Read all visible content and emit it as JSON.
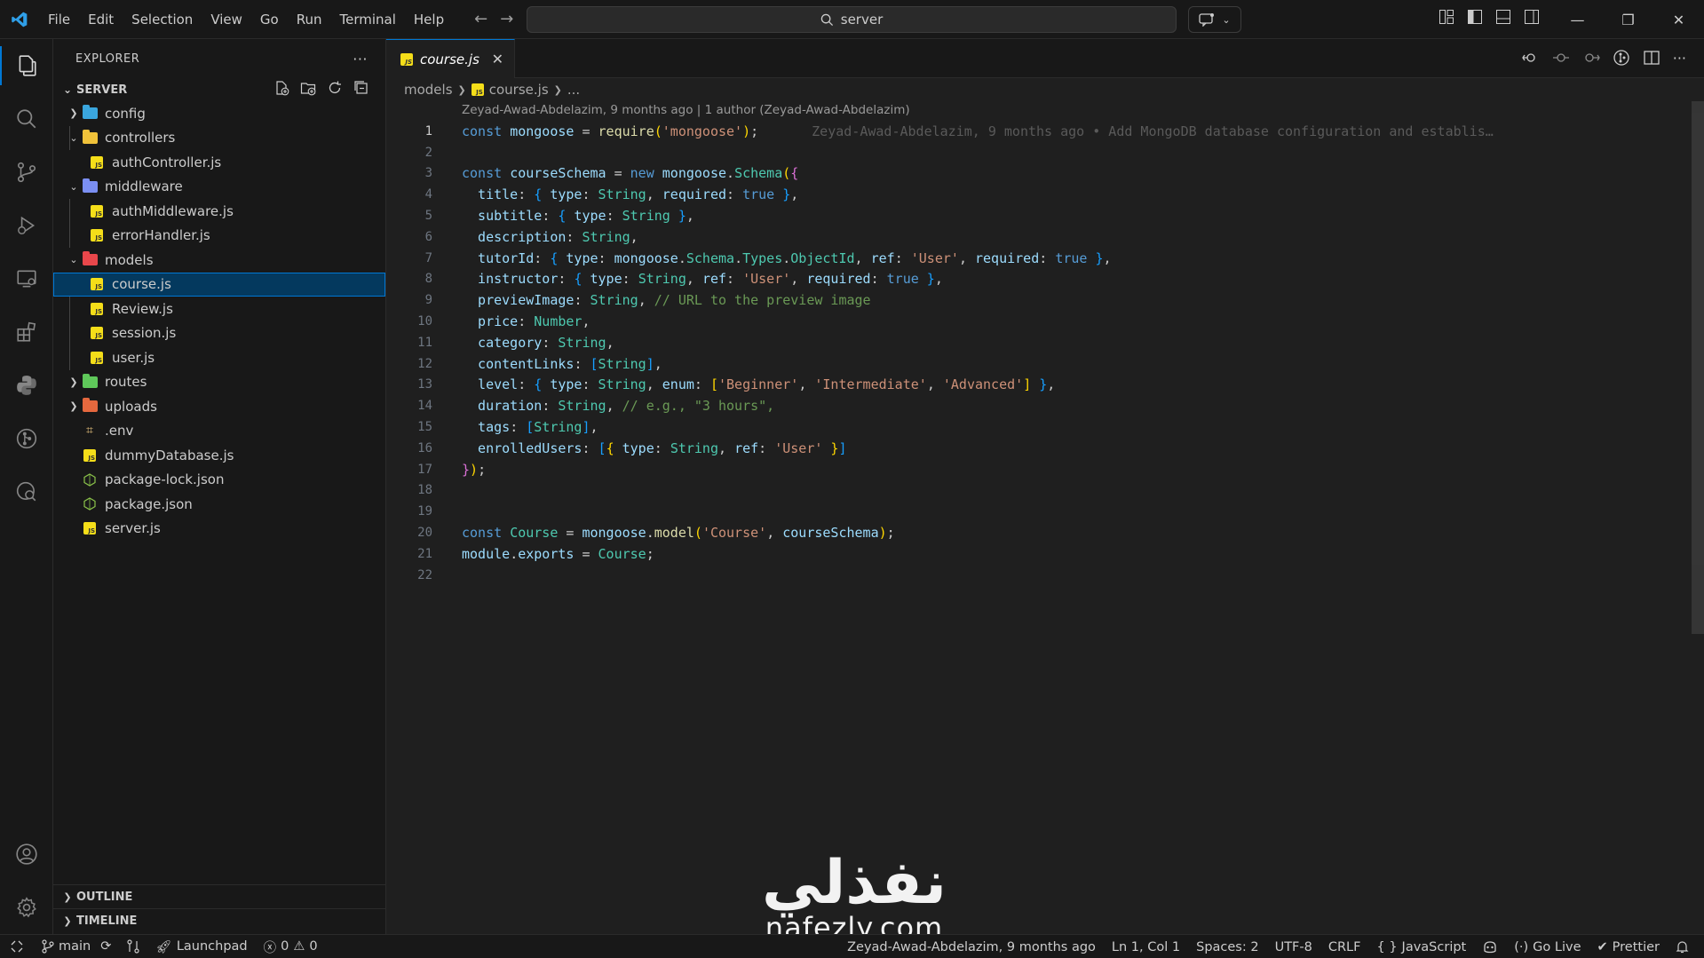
{
  "menu": [
    "File",
    "Edit",
    "Selection",
    "View",
    "Go",
    "Run",
    "Terminal",
    "Help"
  ],
  "search": {
    "text": "server"
  },
  "explorer": {
    "title": "EXPLORER",
    "root": "SERVER",
    "items": [
      {
        "label": "config",
        "type": "folder",
        "level": 0,
        "expanded": false,
        "color": "#3aa6de"
      },
      {
        "label": "controllers",
        "type": "folder",
        "level": 0,
        "expanded": true,
        "color": "#f0c23a"
      },
      {
        "label": "authController.js",
        "type": "js",
        "level": 1
      },
      {
        "label": "middleware",
        "type": "folder",
        "level": 0,
        "expanded": true,
        "color": "#7b8ff2"
      },
      {
        "label": "authMiddleware.js",
        "type": "js",
        "level": 1
      },
      {
        "label": "errorHandler.js",
        "type": "js",
        "level": 1
      },
      {
        "label": "models",
        "type": "folder",
        "level": 0,
        "expanded": true,
        "color": "#e8474b"
      },
      {
        "label": "course.js",
        "type": "js",
        "level": 1,
        "selected": true
      },
      {
        "label": "Review.js",
        "type": "js",
        "level": 1
      },
      {
        "label": "session.js",
        "type": "js",
        "level": 1
      },
      {
        "label": "user.js",
        "type": "js",
        "level": 1
      },
      {
        "label": "routes",
        "type": "folder",
        "level": 0,
        "expanded": false,
        "color": "#5fc85a"
      },
      {
        "label": "uploads",
        "type": "folder",
        "level": 0,
        "expanded": false,
        "color": "#e5683e"
      },
      {
        "label": ".env",
        "type": "env",
        "level": 0
      },
      {
        "label": "dummyDatabase.js",
        "type": "js",
        "level": 0
      },
      {
        "label": "package-lock.json",
        "type": "json",
        "level": 0
      },
      {
        "label": "package.json",
        "type": "json",
        "level": 0
      },
      {
        "label": "server.js",
        "type": "js",
        "level": 0
      }
    ],
    "outline": "OUTLINE",
    "timeline": "TIMELINE"
  },
  "tab": {
    "label": "course.js"
  },
  "breadcrumb": {
    "folder": "models",
    "file": "course.js",
    "more": "..."
  },
  "blame": {
    "header": "Zeyad-Awad-Abdelazim, 9 months ago | 1 author (Zeyad-Awad-Abdelazim)",
    "inline": "Zeyad-Awad-Abdelazim, 9 months ago • Add MongoDB database configuration and establis…"
  },
  "code_lines": [
    [
      [
        "k",
        "const "
      ],
      [
        "v",
        "mongoose"
      ],
      [
        "p",
        " = "
      ],
      [
        "f",
        "require"
      ],
      [
        "b1",
        "("
      ],
      [
        "s",
        "'mongoose'"
      ],
      [
        "b1",
        ")"
      ],
      [
        "p",
        ";"
      ]
    ],
    [],
    [
      [
        "k",
        "const "
      ],
      [
        "v",
        "courseSchema"
      ],
      [
        "p",
        " = "
      ],
      [
        "k",
        "new "
      ],
      [
        "v",
        "mongoose"
      ],
      [
        "p",
        "."
      ],
      [
        "c",
        "Schema"
      ],
      [
        "b1",
        "("
      ],
      [
        "b2",
        "{"
      ]
    ],
    [
      [
        "v",
        "  title"
      ],
      [
        "p",
        ": "
      ],
      [
        "b3",
        "{ "
      ],
      [
        "v",
        "type"
      ],
      [
        "p",
        ": "
      ],
      [
        "c",
        "String"
      ],
      [
        "p",
        ", "
      ],
      [
        "v",
        "required"
      ],
      [
        "p",
        ": "
      ],
      [
        "k",
        "true"
      ],
      [
        "b3",
        " }"
      ],
      [
        "p",
        ","
      ]
    ],
    [
      [
        "v",
        "  subtitle"
      ],
      [
        "p",
        ": "
      ],
      [
        "b3",
        "{ "
      ],
      [
        "v",
        "type"
      ],
      [
        "p",
        ": "
      ],
      [
        "c",
        "String"
      ],
      [
        "b3",
        " }"
      ],
      [
        "p",
        ","
      ]
    ],
    [
      [
        "v",
        "  description"
      ],
      [
        "p",
        ": "
      ],
      [
        "c",
        "String"
      ],
      [
        "p",
        ","
      ]
    ],
    [
      [
        "v",
        "  tutorId"
      ],
      [
        "p",
        ": "
      ],
      [
        "b3",
        "{ "
      ],
      [
        "v",
        "type"
      ],
      [
        "p",
        ": "
      ],
      [
        "v",
        "mongoose"
      ],
      [
        "p",
        "."
      ],
      [
        "c",
        "Schema"
      ],
      [
        "p",
        "."
      ],
      [
        "c",
        "Types"
      ],
      [
        "p",
        "."
      ],
      [
        "c",
        "ObjectId"
      ],
      [
        "p",
        ", "
      ],
      [
        "v",
        "ref"
      ],
      [
        "p",
        ": "
      ],
      [
        "s",
        "'User'"
      ],
      [
        "p",
        ", "
      ],
      [
        "v",
        "required"
      ],
      [
        "p",
        ": "
      ],
      [
        "k",
        "true"
      ],
      [
        "b3",
        " }"
      ],
      [
        "p",
        ","
      ]
    ],
    [
      [
        "v",
        "  instructor"
      ],
      [
        "p",
        ": "
      ],
      [
        "b3",
        "{ "
      ],
      [
        "v",
        "type"
      ],
      [
        "p",
        ": "
      ],
      [
        "c",
        "String"
      ],
      [
        "p",
        ", "
      ],
      [
        "v",
        "ref"
      ],
      [
        "p",
        ": "
      ],
      [
        "s",
        "'User'"
      ],
      [
        "p",
        ", "
      ],
      [
        "v",
        "required"
      ],
      [
        "p",
        ": "
      ],
      [
        "k",
        "true"
      ],
      [
        "b3",
        " }"
      ],
      [
        "p",
        ","
      ]
    ],
    [
      [
        "v",
        "  previewImage"
      ],
      [
        "p",
        ": "
      ],
      [
        "c",
        "String"
      ],
      [
        "p",
        ", "
      ],
      [
        "cm",
        "// URL to the preview image"
      ]
    ],
    [
      [
        "v",
        "  price"
      ],
      [
        "p",
        ": "
      ],
      [
        "c",
        "Number"
      ],
      [
        "p",
        ","
      ]
    ],
    [
      [
        "v",
        "  category"
      ],
      [
        "p",
        ": "
      ],
      [
        "c",
        "String"
      ],
      [
        "p",
        ","
      ]
    ],
    [
      [
        "v",
        "  contentLinks"
      ],
      [
        "p",
        ": "
      ],
      [
        "b3",
        "["
      ],
      [
        "c",
        "String"
      ],
      [
        "b3",
        "]"
      ],
      [
        "p",
        ","
      ]
    ],
    [
      [
        "v",
        "  level"
      ],
      [
        "p",
        ": "
      ],
      [
        "b3",
        "{ "
      ],
      [
        "v",
        "type"
      ],
      [
        "p",
        ": "
      ],
      [
        "c",
        "String"
      ],
      [
        "p",
        ", "
      ],
      [
        "v",
        "enum"
      ],
      [
        "p",
        ": "
      ],
      [
        "b1",
        "["
      ],
      [
        "s",
        "'Beginner'"
      ],
      [
        "p",
        ", "
      ],
      [
        "s",
        "'Intermediate'"
      ],
      [
        "p",
        ", "
      ],
      [
        "s",
        "'Advanced'"
      ],
      [
        "b1",
        "]"
      ],
      [
        "b3",
        " }"
      ],
      [
        "p",
        ","
      ]
    ],
    [
      [
        "v",
        "  duration"
      ],
      [
        "p",
        ": "
      ],
      [
        "c",
        "String"
      ],
      [
        "p",
        ", "
      ],
      [
        "cm",
        "// e.g., \"3 hours\","
      ]
    ],
    [
      [
        "v",
        "  tags"
      ],
      [
        "p",
        ": "
      ],
      [
        "b3",
        "["
      ],
      [
        "c",
        "String"
      ],
      [
        "b3",
        "]"
      ],
      [
        "p",
        ","
      ]
    ],
    [
      [
        "v",
        "  enrolledUsers"
      ],
      [
        "p",
        ": "
      ],
      [
        "b3",
        "["
      ],
      [
        "b1",
        "{ "
      ],
      [
        "v",
        "type"
      ],
      [
        "p",
        ": "
      ],
      [
        "c",
        "String"
      ],
      [
        "p",
        ", "
      ],
      [
        "v",
        "ref"
      ],
      [
        "p",
        ": "
      ],
      [
        "s",
        "'User'"
      ],
      [
        "b1",
        " }"
      ],
      [
        "b3",
        "]"
      ]
    ],
    [
      [
        "b2",
        "}"
      ],
      [
        "b1",
        ")"
      ],
      [
        "p",
        ";"
      ]
    ],
    [],
    [],
    [
      [
        "k",
        "const "
      ],
      [
        "c",
        "Course"
      ],
      [
        "p",
        " = "
      ],
      [
        "v",
        "mongoose"
      ],
      [
        "p",
        "."
      ],
      [
        "f",
        "model"
      ],
      [
        "b1",
        "("
      ],
      [
        "s",
        "'Course'"
      ],
      [
        "p",
        ", "
      ],
      [
        "v",
        "courseSchema"
      ],
      [
        "b1",
        ")"
      ],
      [
        "p",
        ";"
      ]
    ],
    [
      [
        "v",
        "module"
      ],
      [
        "p",
        "."
      ],
      [
        "v",
        "exports"
      ],
      [
        "p",
        " = "
      ],
      [
        "c",
        "Course"
      ],
      [
        "p",
        ";"
      ]
    ],
    []
  ],
  "watermark": {
    "arabic": "نفذلي",
    "latin": "nafezly.com"
  },
  "status": {
    "branch": "main",
    "launchpad": "Launchpad",
    "errors": "0",
    "warnings": "0",
    "blame": "Zeyad-Awad-Abdelazim, 9 months ago",
    "position": "Ln 1, Col 1",
    "spaces": "Spaces: 2",
    "encoding": "UTF-8",
    "eol": "CRLF",
    "language": "JavaScript",
    "golive": "Go Live",
    "prettier": "Prettier"
  }
}
